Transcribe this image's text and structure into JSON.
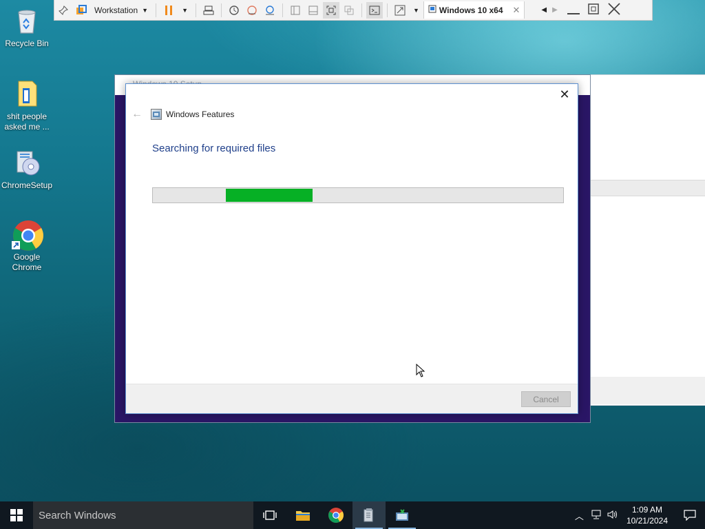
{
  "desktop": {
    "icons": [
      {
        "label": "Recycle Bin"
      },
      {
        "label": "shit people asked me ..."
      },
      {
        "label": "ChromeSetup"
      },
      {
        "label": "Google Chrome"
      }
    ]
  },
  "vm_toolbar": {
    "library_label": "Workstation",
    "tab_label": "Windows 10 x64"
  },
  "setup_window": {
    "title": "Windows 10 Setup"
  },
  "dialog": {
    "app_title": "Windows Features",
    "heading": "Searching for required files",
    "progress": {
      "start_fraction": 0.178,
      "end_fraction": 0.39
    },
    "cancel_label": "Cancel"
  },
  "taskbar": {
    "search_placeholder": "Search Windows",
    "clock_time": "1:09 AM",
    "clock_date": "10/21/2024"
  },
  "colors": {
    "progress_fill": "#06b025",
    "heading_text": "#1f3f8a",
    "taskbar": "#101820"
  }
}
